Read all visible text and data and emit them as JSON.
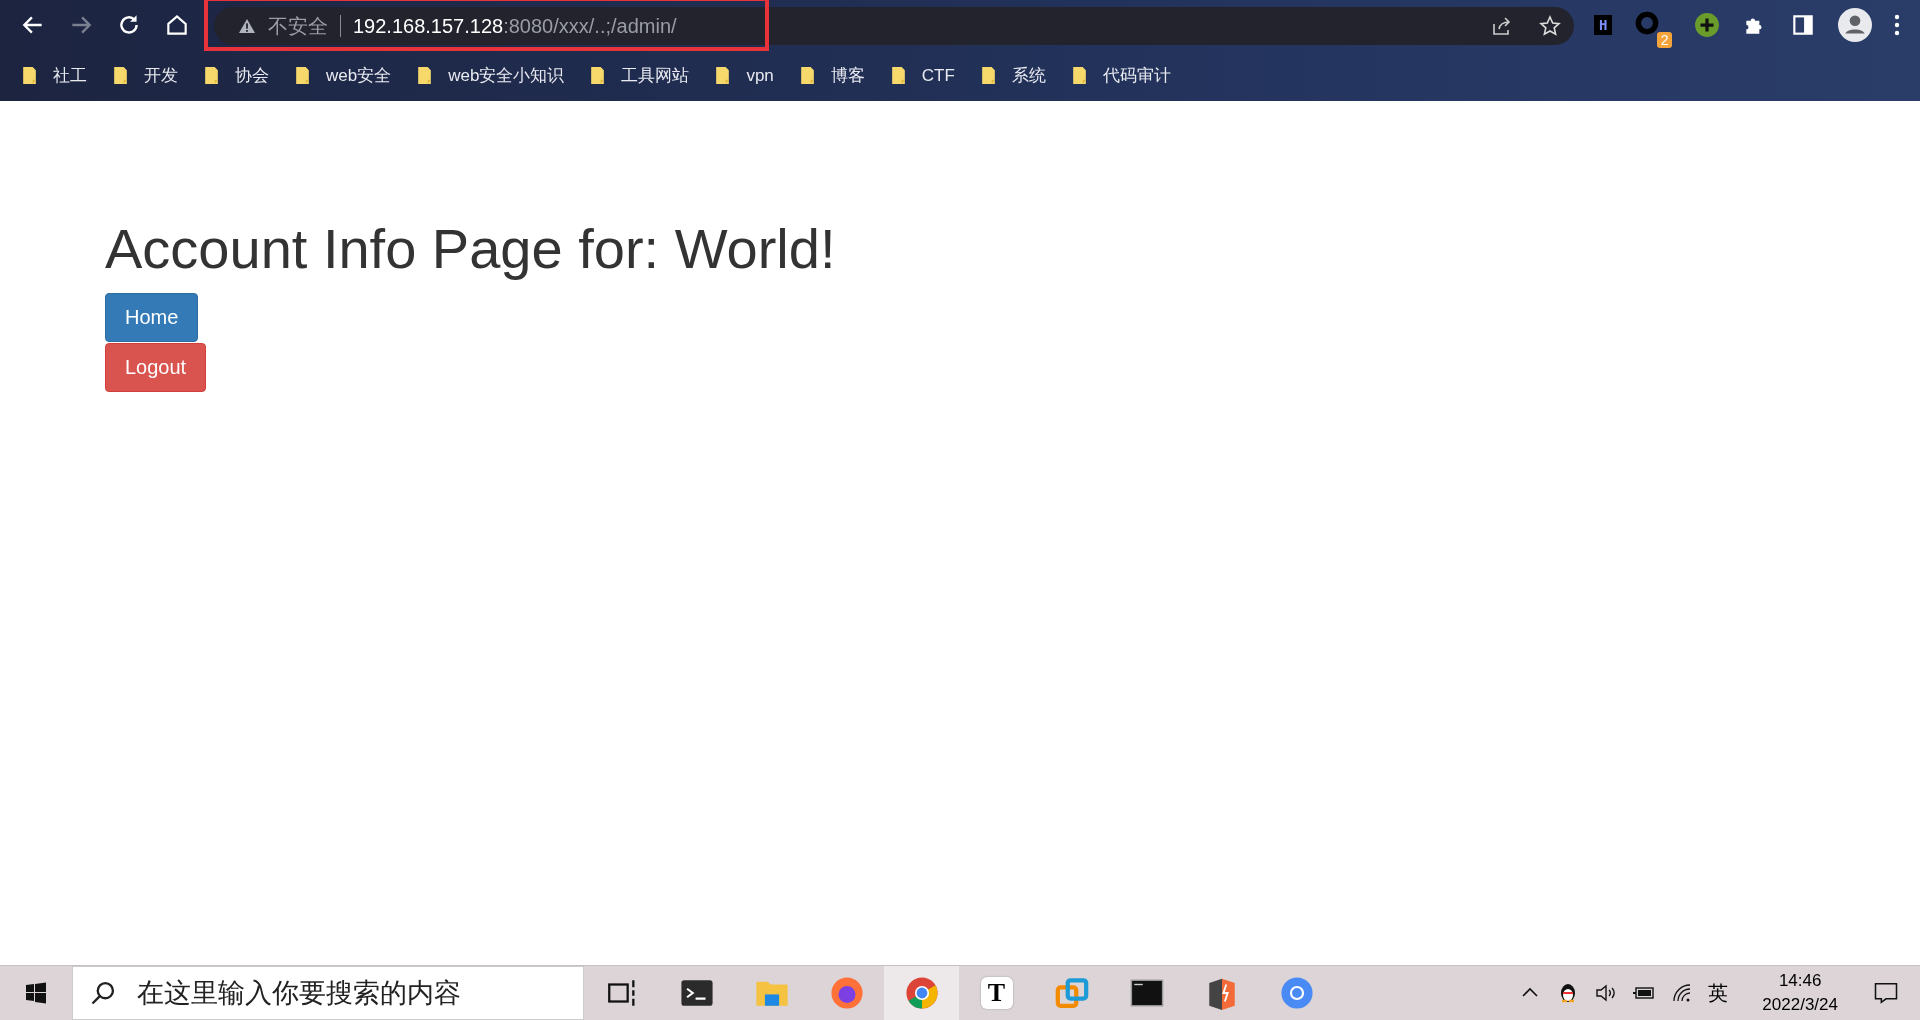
{
  "browser": {
    "address": {
      "security_label": "不安全",
      "host": "192.168.157.128",
      "rest": ":8080/xxx/..;/admin/",
      "highlighted": true
    },
    "extensions": [
      {
        "kind": "letter",
        "glyph": "H"
      },
      {
        "kind": "ring",
        "badge": "2"
      },
      {
        "kind": "plus"
      },
      {
        "kind": "puzzle"
      },
      {
        "kind": "sidepanel"
      }
    ],
    "bookmarks": [
      "社工",
      "开发",
      "协会",
      "web安全",
      "web安全小知识",
      "工具网站",
      "vpn",
      "博客",
      "CTF",
      "系统",
      "代码审计"
    ]
  },
  "page": {
    "heading": "Account Info Page for: World!",
    "buttons": [
      {
        "label": "Home",
        "kind": "primary"
      },
      {
        "label": "Logout",
        "kind": "danger"
      }
    ]
  },
  "taskbar": {
    "search_placeholder": "在这里输入你要搜索的内容",
    "apps": [
      {
        "kind": "taskview",
        "selected": false
      },
      {
        "kind": "terminal",
        "selected": false
      },
      {
        "kind": "folder",
        "selected": false
      },
      {
        "kind": "firefox",
        "selected": false
      },
      {
        "kind": "chrome",
        "selected": true
      },
      {
        "kind": "letter",
        "glyph": "T",
        "selected": false
      },
      {
        "kind": "vm",
        "selected": false
      },
      {
        "kind": "cmd",
        "selected": false
      },
      {
        "kind": "bolt",
        "selected": false
      },
      {
        "kind": "chromium",
        "selected": false
      }
    ],
    "input_method": "英",
    "time": "14:46",
    "date": "2022/3/24"
  }
}
